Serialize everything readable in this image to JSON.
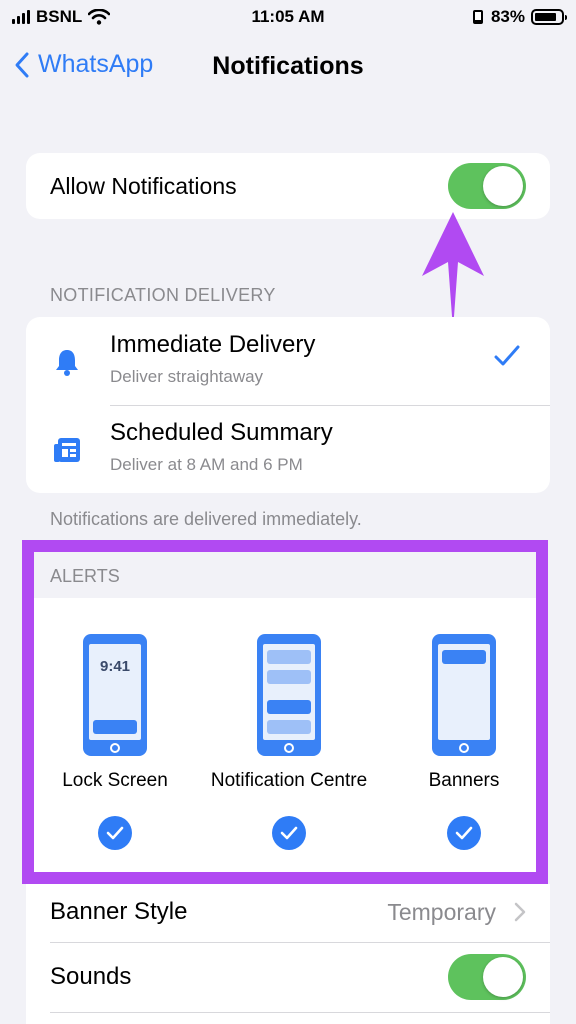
{
  "status_bar": {
    "carrier": "BSNL",
    "time": "11:05 AM",
    "battery_percent": "83%",
    "battery_level": 0.83
  },
  "nav": {
    "back_label": "WhatsApp",
    "title": "Notifications"
  },
  "allow": {
    "label": "Allow Notifications",
    "enabled": true
  },
  "delivery": {
    "header": "NOTIFICATION DELIVERY",
    "options": [
      {
        "title": "Immediate Delivery",
        "subtitle": "Deliver straightaway",
        "icon": "bell-icon",
        "selected": true
      },
      {
        "title": "Scheduled Summary",
        "subtitle": "Deliver at 8 AM and 6 PM",
        "icon": "summary-icon",
        "selected": false
      }
    ],
    "footer": "Notifications are delivered immediately."
  },
  "alerts": {
    "header": "ALERTS",
    "items": [
      {
        "label": "Lock Screen",
        "preview_time": "9:41",
        "checked": true
      },
      {
        "label": "Notification Centre",
        "checked": true
      },
      {
        "label": "Banners",
        "checked": true
      }
    ]
  },
  "settings": {
    "banner_style_label": "Banner Style",
    "banner_style_value": "Temporary",
    "sounds_label": "Sounds",
    "sounds_enabled": true
  },
  "colors": {
    "accent": "#2f7cf6",
    "toggle_on": "#5ec25d",
    "highlight": "#b14af2",
    "background": "#f2f2f7"
  }
}
